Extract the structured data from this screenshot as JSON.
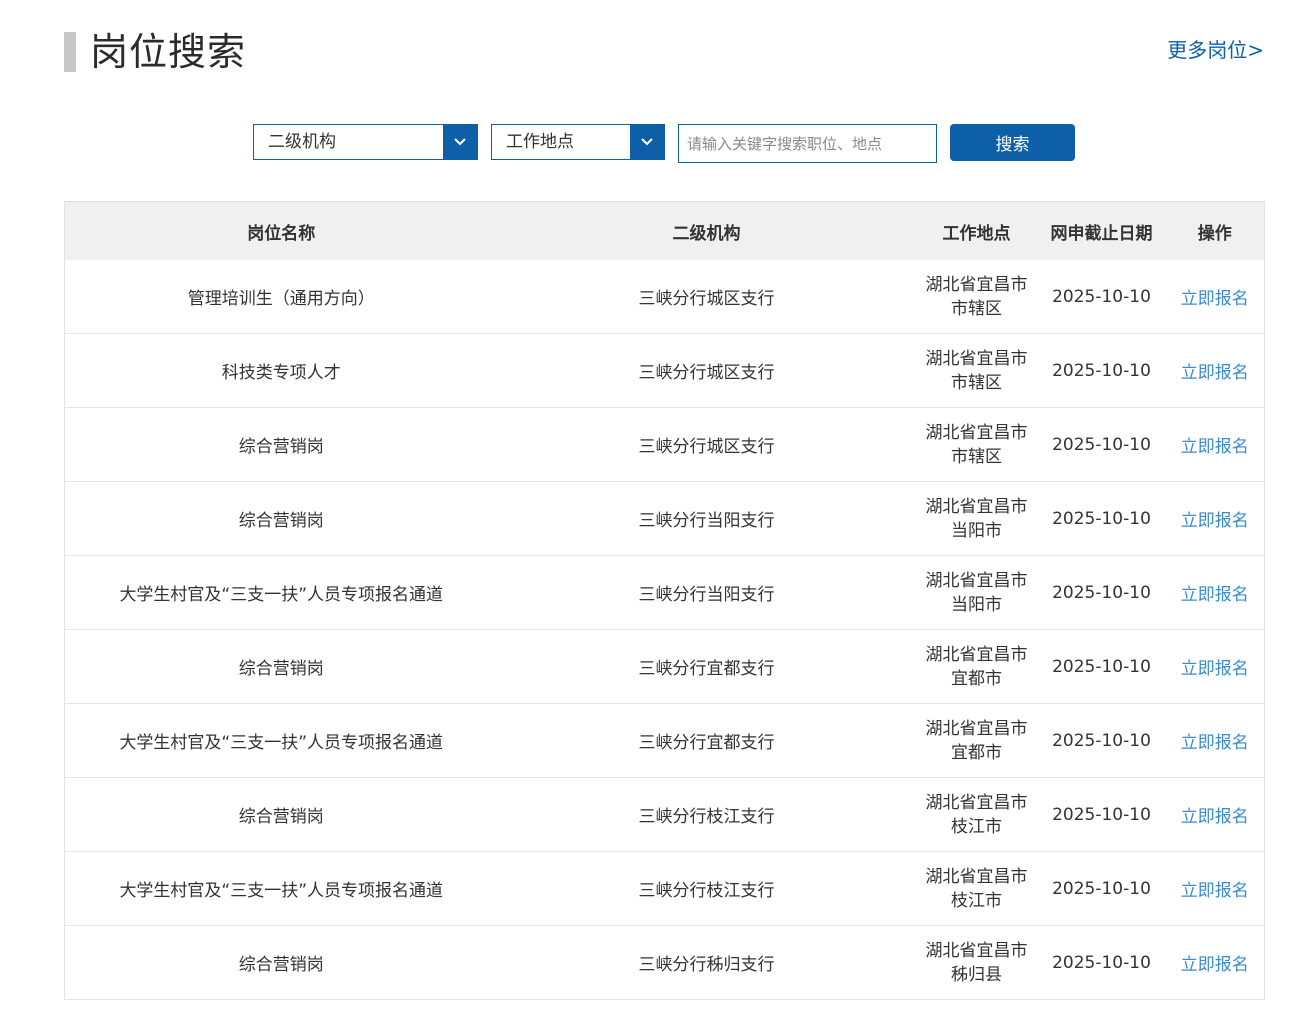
{
  "header": {
    "title": "岗位搜索",
    "more_link": "更多岗位>"
  },
  "filters": {
    "org_select": "二级机构",
    "location_select": "工作地点",
    "search_placeholder": "请输入关键字搜索职位、地点",
    "search_button": "搜索"
  },
  "table": {
    "columns": [
      "岗位名称",
      "二级机构",
      "工作地点",
      "网申截止日期",
      "操作"
    ],
    "rows": [
      {
        "name": "管理培训生（通用方向）",
        "org": "三峡分行城区支行",
        "loc1": "湖北省宜昌市",
        "loc2": "市辖区",
        "deadline": "2025-10-10",
        "action": "立即报名"
      },
      {
        "name": "科技类专项人才",
        "org": "三峡分行城区支行",
        "loc1": "湖北省宜昌市",
        "loc2": "市辖区",
        "deadline": "2025-10-10",
        "action": "立即报名"
      },
      {
        "name": "综合营销岗",
        "org": "三峡分行城区支行",
        "loc1": "湖北省宜昌市",
        "loc2": "市辖区",
        "deadline": "2025-10-10",
        "action": "立即报名"
      },
      {
        "name": "综合营销岗",
        "org": "三峡分行当阳支行",
        "loc1": "湖北省宜昌市",
        "loc2": "当阳市",
        "deadline": "2025-10-10",
        "action": "立即报名"
      },
      {
        "name": "大学生村官及“三支一扶”人员专项报名通道",
        "org": "三峡分行当阳支行",
        "loc1": "湖北省宜昌市",
        "loc2": "当阳市",
        "deadline": "2025-10-10",
        "action": "立即报名"
      },
      {
        "name": "综合营销岗",
        "org": "三峡分行宜都支行",
        "loc1": "湖北省宜昌市",
        "loc2": "宜都市",
        "deadline": "2025-10-10",
        "action": "立即报名"
      },
      {
        "name": "大学生村官及“三支一扶”人员专项报名通道",
        "org": "三峡分行宜都支行",
        "loc1": "湖北省宜昌市",
        "loc2": "宜都市",
        "deadline": "2025-10-10",
        "action": "立即报名"
      },
      {
        "name": "综合营销岗",
        "org": "三峡分行枝江支行",
        "loc1": "湖北省宜昌市",
        "loc2": "枝江市",
        "deadline": "2025-10-10",
        "action": "立即报名"
      },
      {
        "name": "大学生村官及“三支一扶”人员专项报名通道",
        "org": "三峡分行枝江支行",
        "loc1": "湖北省宜昌市",
        "loc2": "枝江市",
        "deadline": "2025-10-10",
        "action": "立即报名"
      },
      {
        "name": "综合营销岗",
        "org": "三峡分行秭归支行",
        "loc1": "湖北省宜昌市",
        "loc2": "秭归县",
        "deadline": "2025-10-10",
        "action": "立即报名"
      }
    ]
  },
  "colors": {
    "accent": "#0d5fa8",
    "link": "#3a8bd0",
    "header_bg": "#f0f0f0"
  }
}
